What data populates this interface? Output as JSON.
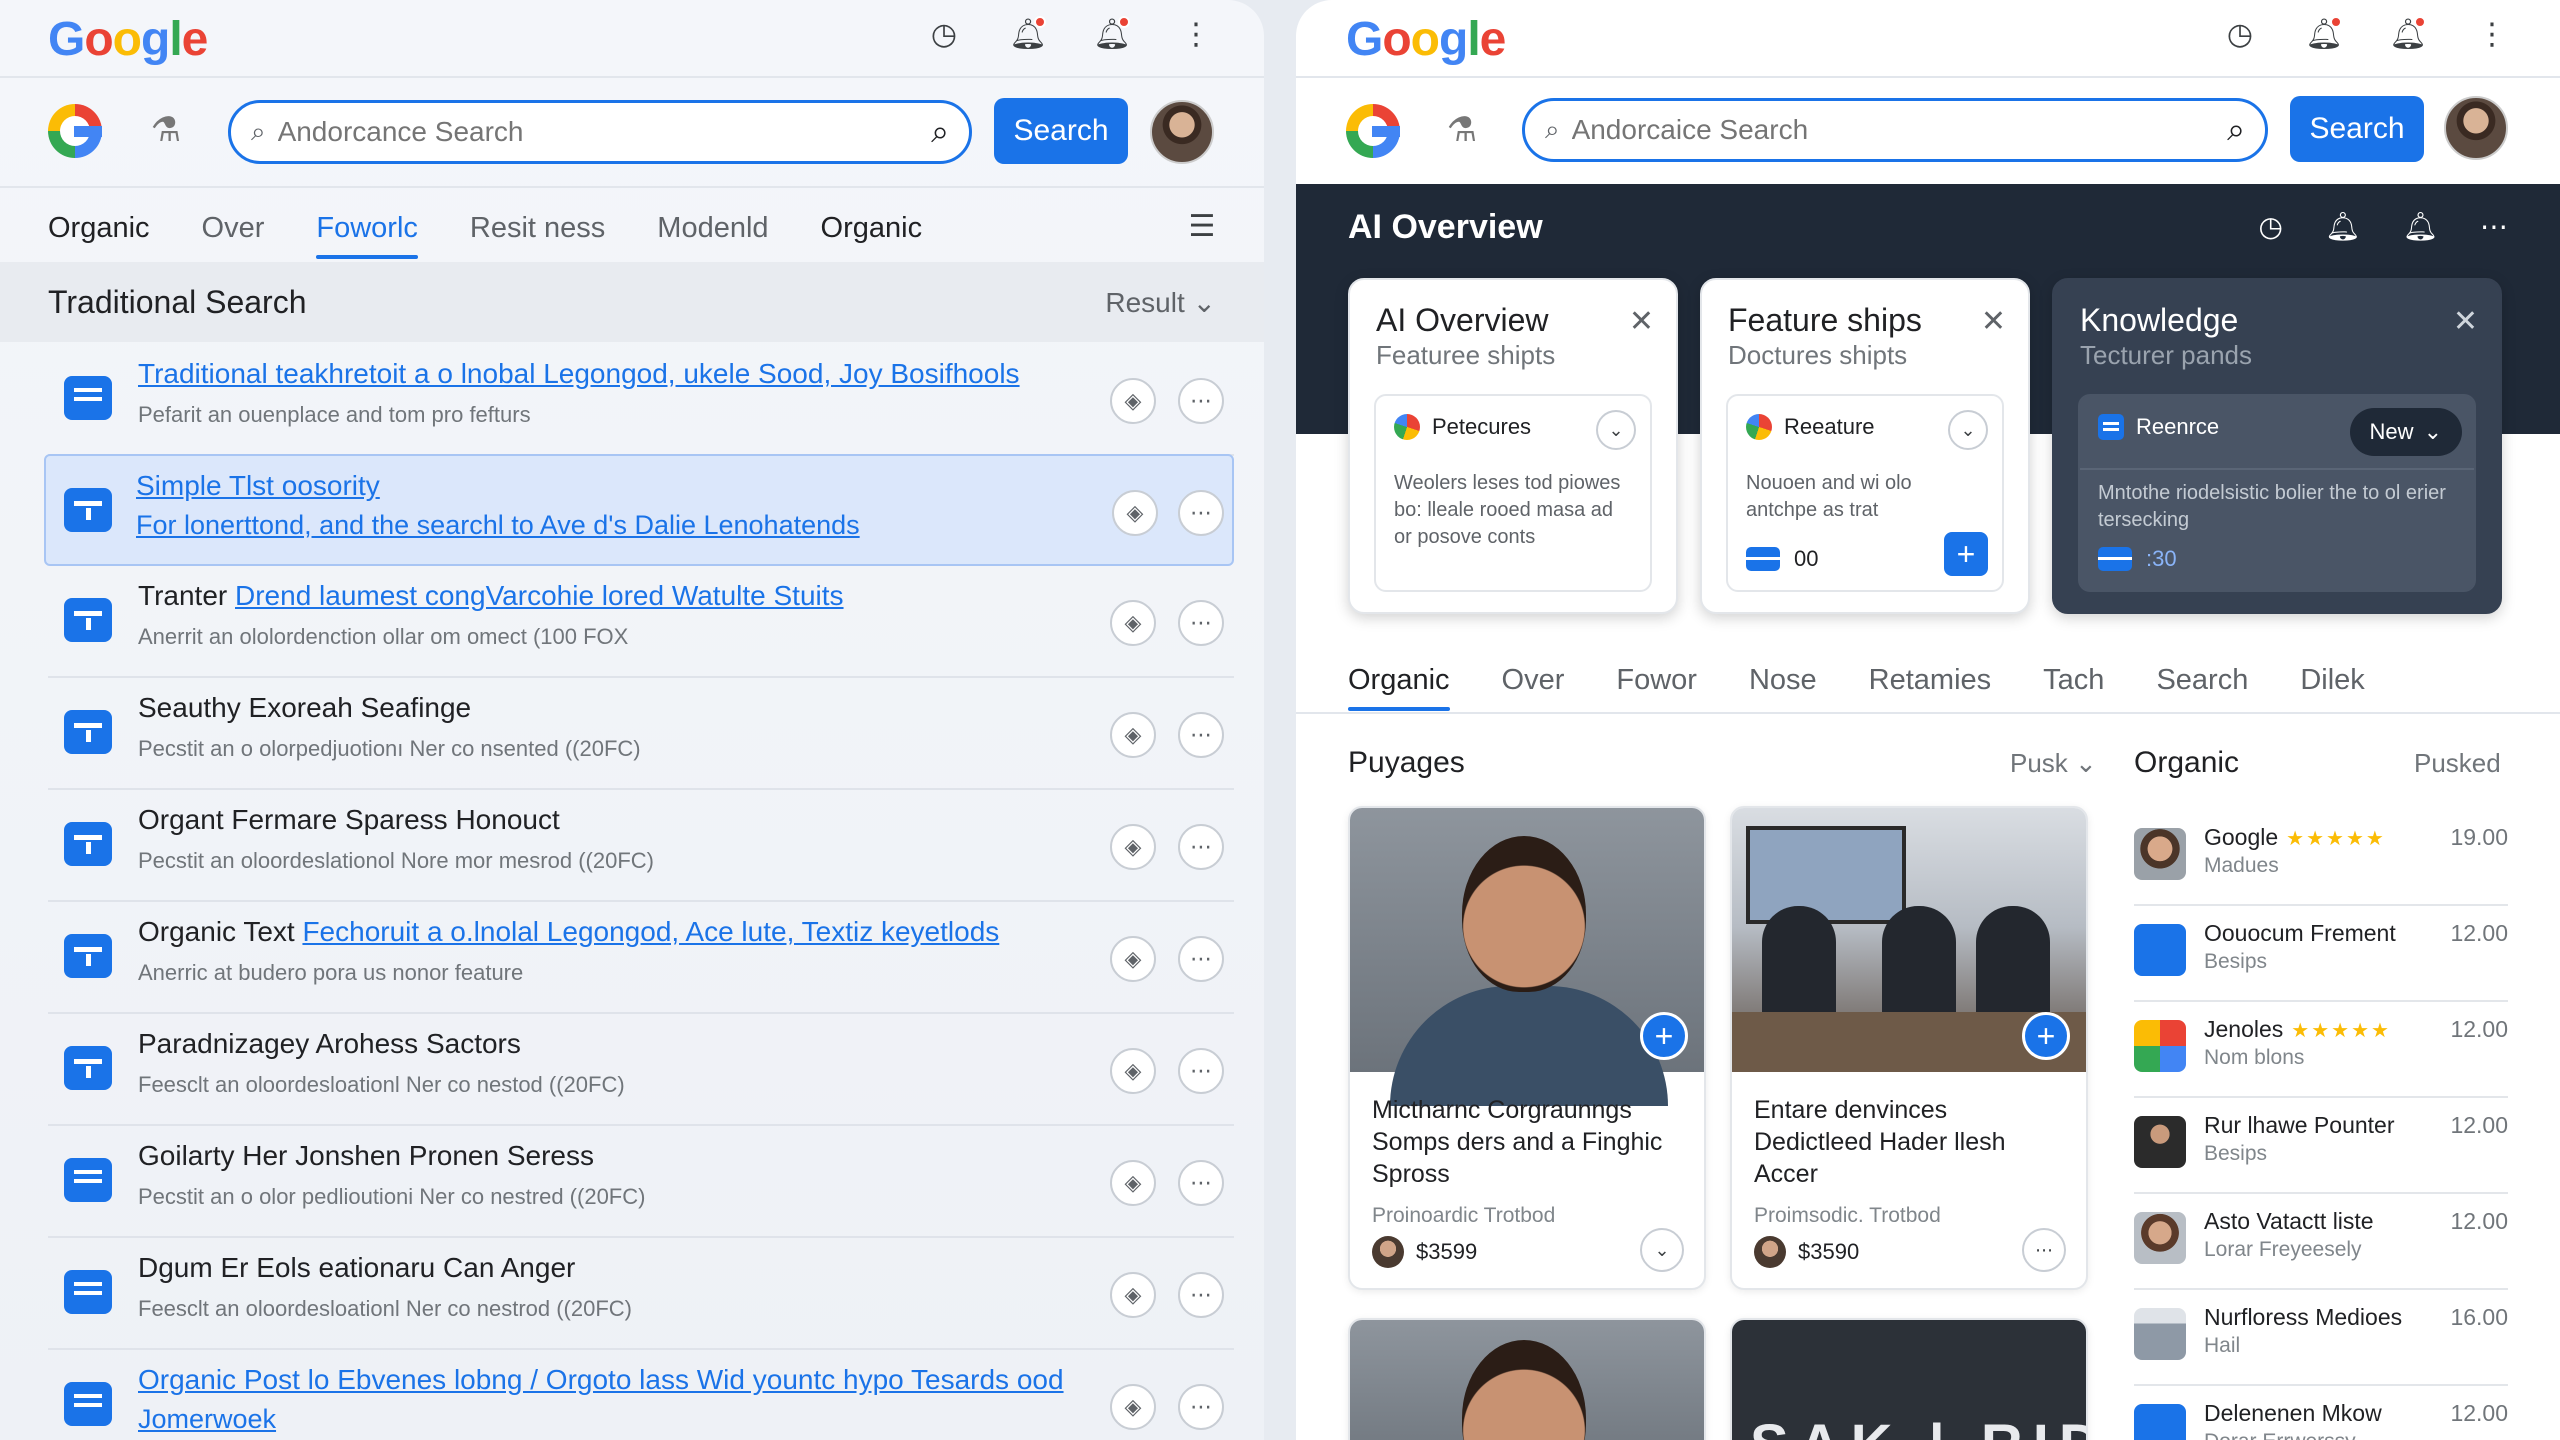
{
  "left": {
    "brand": "Google",
    "search": {
      "placeholder": "Andorcance Search",
      "button": "Search"
    },
    "tabs": [
      "Organic",
      "Over",
      "Foworlc",
      "Resit ness",
      "Modenld",
      "Organic"
    ],
    "section": {
      "title": "Traditional Search",
      "sort": "Result"
    },
    "results": [
      {
        "title_plain": "",
        "title_link": "Traditional teakhretoit a o lnobal Legongod, ukele Sood, Joy Bosifhools",
        "sub": "Pefarit an ouenplace and tom pro fefturs",
        "sub_link": ""
      },
      {
        "title_plain": "",
        "title_link": "Simple Tlst oosority",
        "sub": "",
        "sub_link": "For lonerttond, and the searchl to Ave d's Dalie Lenohatends"
      },
      {
        "title_plain": "Tranter ",
        "title_link": "Drend laumest congVarcohie lored Watulte Stuits",
        "sub": "Anerrit an ololordenction ollar om omect (100 FOX",
        "sub_link": ""
      },
      {
        "title_plain": "Seauthy Exoreah Seafinge",
        "title_link": "",
        "sub": "Pecstit an o olorpedjuotionı Ner co nsented ((20FC)",
        "sub_link": ""
      },
      {
        "title_plain": "Organt Fermare Sparess Honouct",
        "title_link": "",
        "sub": "Pecstit an oloordeslationol Nore mor mesrod ((20FC)",
        "sub_link": ""
      },
      {
        "title_plain": "Organic Text ",
        "title_link": "Fechoruit a o.lnolal Legongod, Ace lute, Textiz keyetlods",
        "sub": "Anerric at budero pora us nonor feature",
        "sub_link": ""
      },
      {
        "title_plain": "Paradnizagey Arohess Sactors",
        "title_link": "",
        "sub": "Feesclt an oloordesloationl Ner co nestod ((20FC)",
        "sub_link": ""
      },
      {
        "title_plain": "Goilarty Her Jonshen Pronen Seress",
        "title_link": "",
        "sub": "Pecstit an o olor pedlioutioni Ner co nestred ((20FC)",
        "sub_link": ""
      },
      {
        "title_plain": "Dgum Er Eols eationaru Can Anger",
        "title_link": "",
        "sub": "Feesclt an oloordesloationl Ner co nestrod ((20FC)",
        "sub_link": ""
      },
      {
        "title_plain": "",
        "title_link": "Organic Post lo Ebvenes lobng / Orgoto lass Wid yountc hypo Tesards ood",
        "sub": "",
        "sub_link": "Jomerwoek"
      }
    ]
  },
  "right": {
    "brand": "Google",
    "search": {
      "placeholder": "Andorcaice Search",
      "button": "Search"
    },
    "overview": {
      "title": "AI Overview",
      "cards": [
        {
          "title": "AI Overview",
          "sub": "Featuree shipts",
          "item": "Petecures",
          "text": "Weolers leses tod piowes bo: lleale rooed masa ad or posove conts",
          "foot": ""
        },
        {
          "title": "Feature ships",
          "sub": "Doctures shipts",
          "item": "Reeature",
          "text": "Nouoen and wi olo antchpe as trat",
          "foot": "00"
        },
        {
          "title": "Knowledge",
          "sub": "Tecturer pands",
          "item": "Reenrce",
          "badge": "New",
          "text": "Mntothe riodelsistic bolier the to ol erier tersecking",
          "foot": ":30"
        }
      ]
    },
    "tabs": [
      "Organic",
      "Over",
      "Fowor",
      "Nose",
      "Retamies",
      "Tach",
      "Search",
      "Dilek"
    ],
    "pages": {
      "title": "Puyages",
      "sort": "Pusk",
      "cards": [
        {
          "title": "Mictharnc Corgraunngs Somps ders and a Finghic Spross",
          "meta": "Proinoardic Trotbod",
          "price": "$3599"
        },
        {
          "title": "Entare denvinces Dedictleed Hader llesh Accer",
          "meta": "Proimsodic. Trotbod",
          "price": "$3590"
        },
        {
          "stub": ""
        },
        {
          "stub": "SAK | RIDIS"
        }
      ]
    },
    "organic": {
      "title": "Organic",
      "sort": "Pusked",
      "rows": [
        {
          "name": "Google",
          "stars": "★★★★★",
          "sub": "Madues",
          "value": "19.00",
          "thumb": "person"
        },
        {
          "name": "Oouocum Frement",
          "stars": "",
          "sub": "Besips",
          "value": "12.00",
          "thumb": "blue"
        },
        {
          "name": "Jenoles",
          "stars": "★★★★★",
          "sub": "Nom blons",
          "value": "12.00",
          "thumb": "google"
        },
        {
          "name": "Rur lhawe Pounter",
          "stars": "",
          "sub": "Besips",
          "value": "12.00",
          "thumb": "suit"
        },
        {
          "name": "Asto Vatactt liste",
          "stars": "",
          "sub": "Lorar Freyeesely",
          "value": "12.00",
          "thumb": "woman"
        },
        {
          "name": "Nurfloress Medioes",
          "stars": "",
          "sub": "Hail",
          "value": "16.00",
          "thumb": "building"
        },
        {
          "name": "Delenenen Mkow",
          "stars": "",
          "sub": "Dorar Errwerssy",
          "value": "12.00",
          "thumb": "blue"
        }
      ]
    }
  }
}
